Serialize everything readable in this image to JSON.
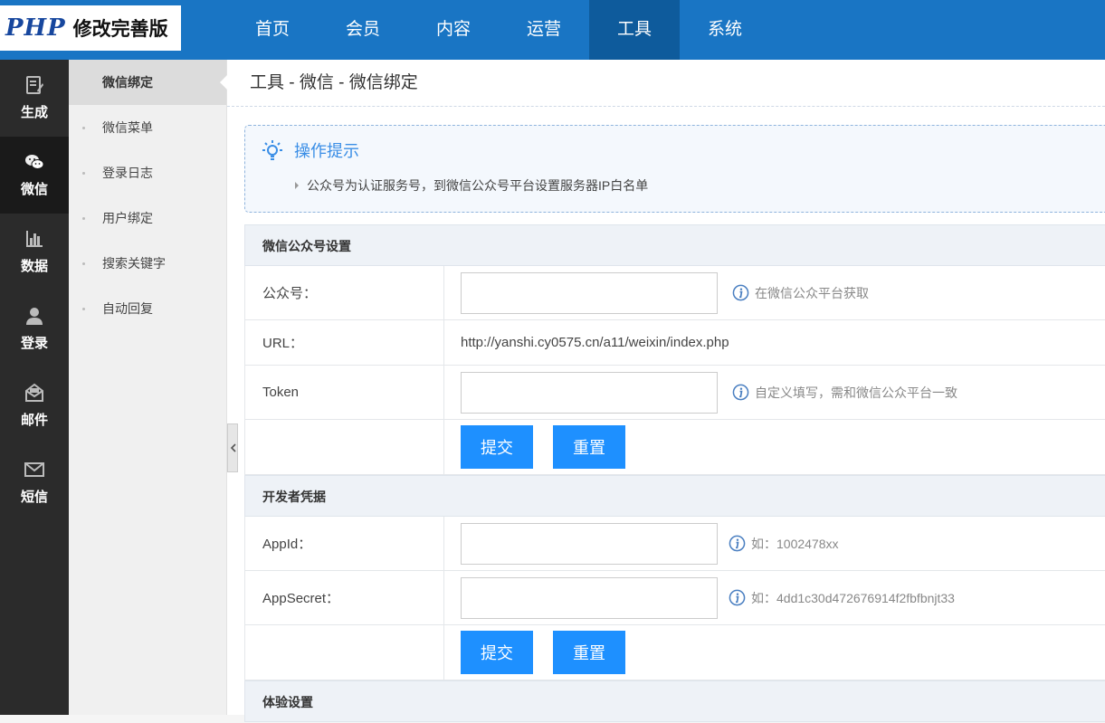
{
  "logo": {
    "brand": "PHP",
    "subtitle": "修改完善版"
  },
  "topnav": {
    "items": [
      {
        "label": "首页"
      },
      {
        "label": "会员"
      },
      {
        "label": "内容"
      },
      {
        "label": "运营"
      },
      {
        "label": "工具",
        "active": true
      },
      {
        "label": "系统"
      }
    ]
  },
  "iconbar": {
    "items": [
      {
        "label": "生成",
        "icon": "edit-icon"
      },
      {
        "label": "微信",
        "icon": "wechat-icon",
        "active": true
      },
      {
        "label": "数据",
        "icon": "chart-icon"
      },
      {
        "label": "登录",
        "icon": "user-icon"
      },
      {
        "label": "邮件",
        "icon": "mailbox-icon"
      },
      {
        "label": "短信",
        "icon": "envelope-icon"
      }
    ]
  },
  "submenu": {
    "items": [
      {
        "label": "微信绑定",
        "active": true
      },
      {
        "label": "微信菜单"
      },
      {
        "label": "登录日志"
      },
      {
        "label": "用户绑定"
      },
      {
        "label": "搜索关键字"
      },
      {
        "label": "自动回复"
      }
    ]
  },
  "breadcrumb": "工具 - 微信 - 微信绑定",
  "tips": {
    "title": "操作提示",
    "line": "公众号为认证服务号，到微信公众号平台设置服务器IP白名单"
  },
  "section1": {
    "title": "微信公众号设置",
    "account_label": "公众号：",
    "account_value": "",
    "account_hint": "在微信公众平台获取",
    "url_label": "URL：",
    "url_value": "http://yanshi.cy0575.cn/a11/weixin/index.php",
    "token_label": "Token",
    "token_value": "",
    "token_hint": "自定义填写，需和微信公众平台一致",
    "submit": "提交",
    "reset": "重置"
  },
  "section2": {
    "title": "开发者凭据",
    "appid_label": "AppId：",
    "appid_value": "",
    "appid_hint": "如：1002478xx",
    "secret_label": "AppSecret：",
    "secret_value": "",
    "secret_hint": "如：4dd1c30d472676914f2fbfbnjt33",
    "submit": "提交",
    "reset": "重置"
  },
  "section3": {
    "title": "体验设置"
  },
  "colors": {
    "topbar": "#1975c4",
    "topbar_active": "#0e5b9c",
    "button": "#1e90ff",
    "sidebar": "#2b2b2b"
  }
}
